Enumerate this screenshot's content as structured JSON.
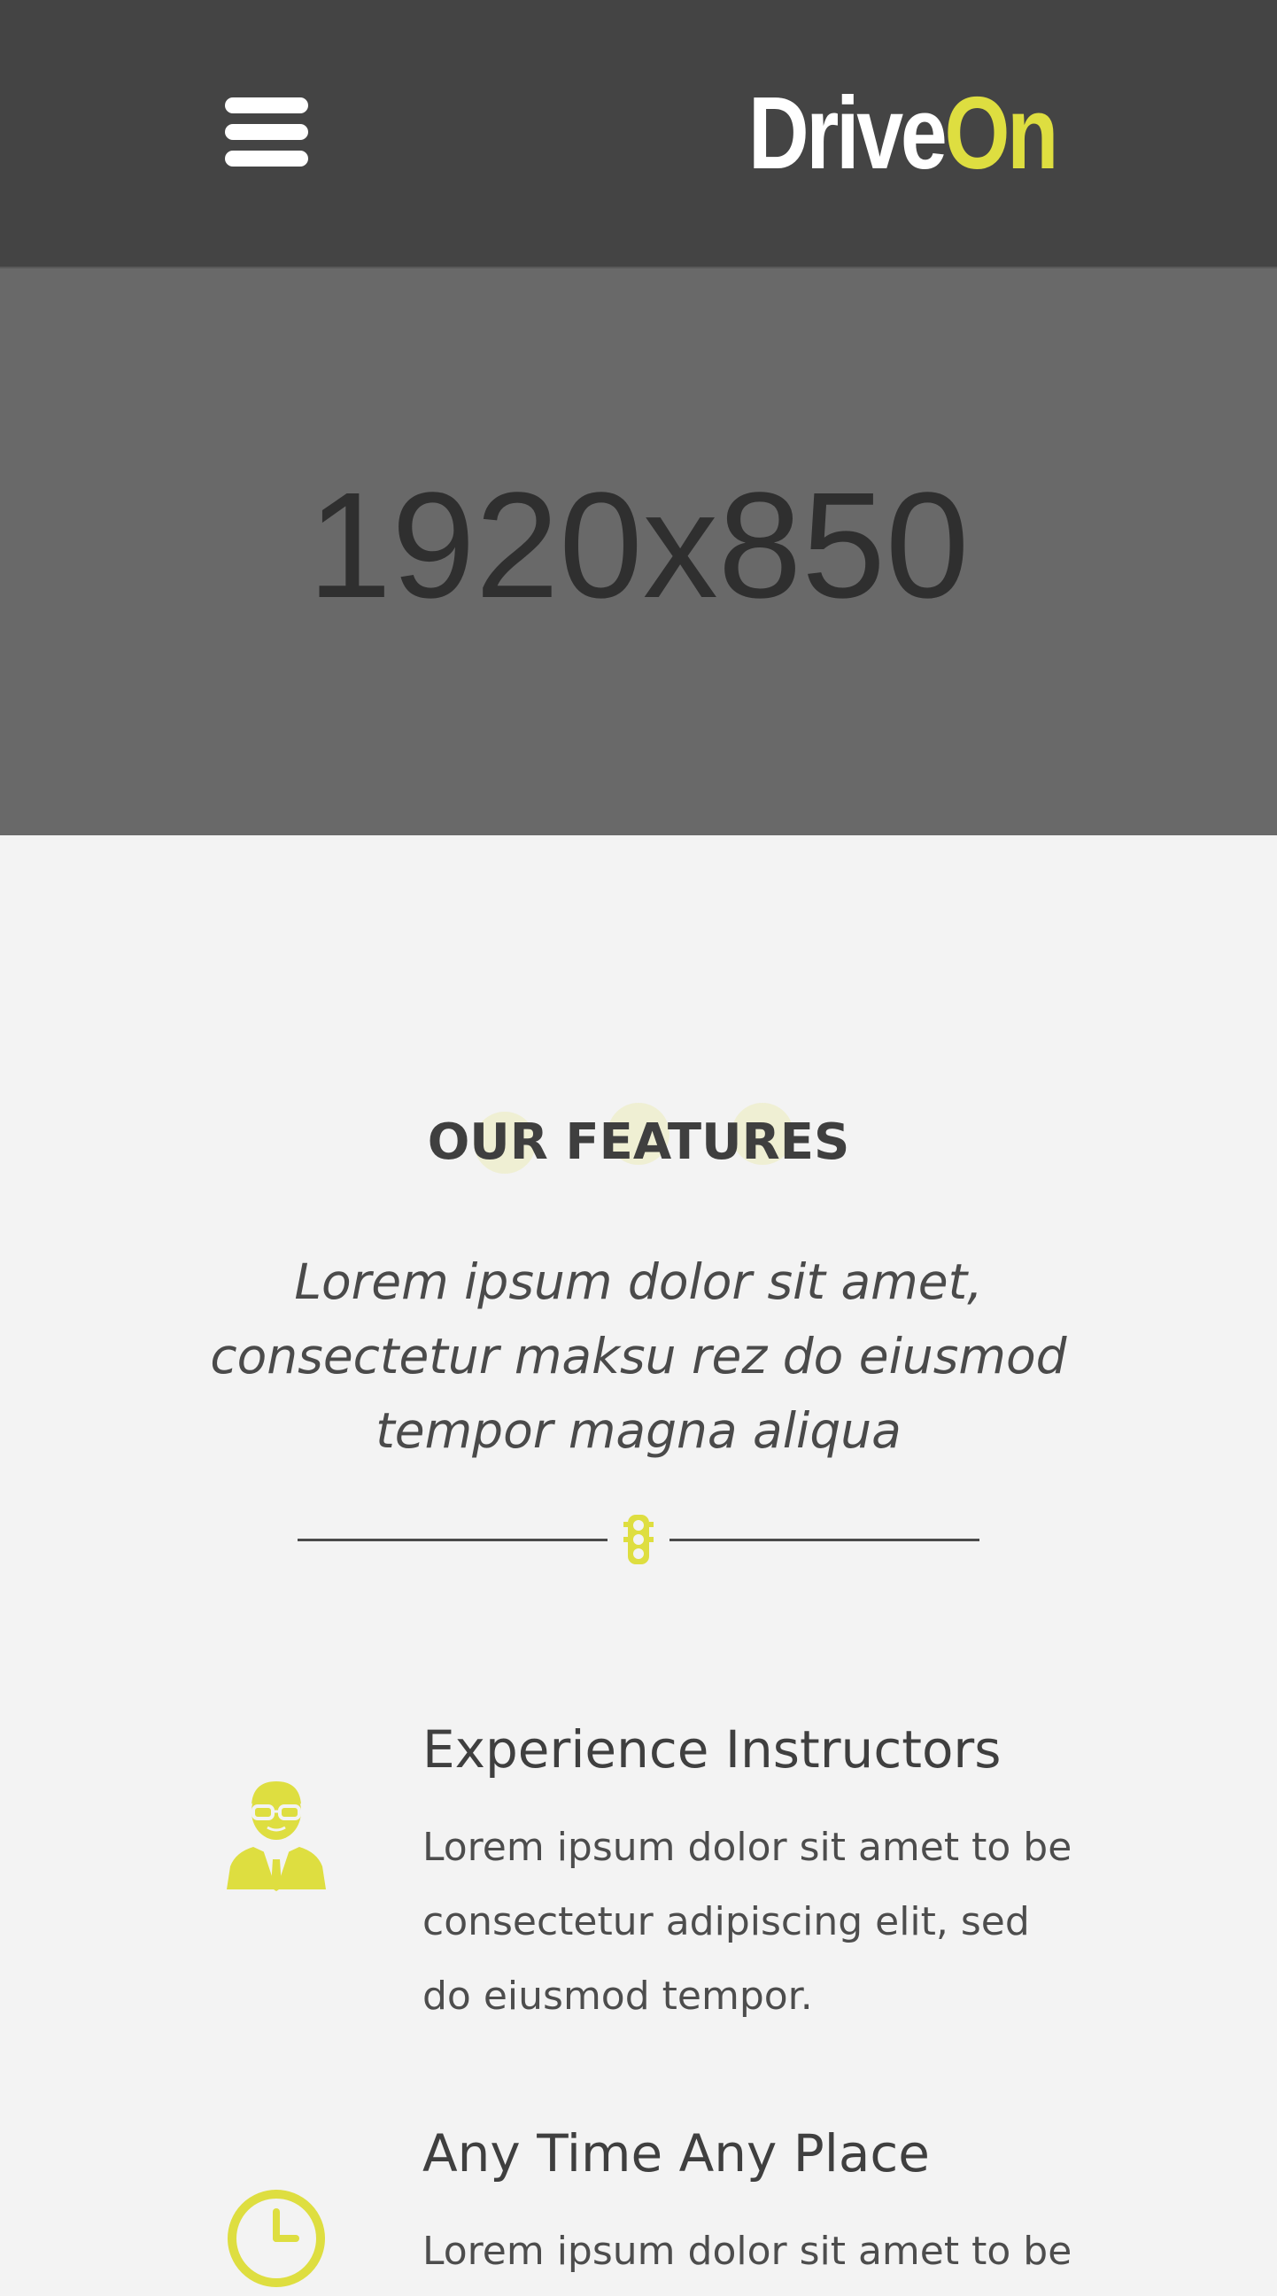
{
  "header": {
    "menu_icon": "hamburger-menu-icon",
    "logo": {
      "part1": "Drive",
      "part2": "On"
    }
  },
  "hero": {
    "placeholder_text": "1920x850"
  },
  "features": {
    "title": "OUR FEATURES",
    "subtitle": "Lorem ipsum dolor sit amet, consectetur maksu rez do eiusmod tempor magna aliqua",
    "divider_icon": "traffic-light-icon",
    "items": [
      {
        "icon": "instructor-icon",
        "heading": "Experience Instructors",
        "text": "Lorem ipsum dolor sit amet to be consectetur adipiscing elit, sed do eiusmod tempor."
      },
      {
        "icon": "clock-icon",
        "heading": "Any Time Any Place",
        "text": "Lorem ipsum dolor sit amet to be"
      }
    ]
  },
  "colors": {
    "accent": "#dede40",
    "header_bg": "#444444",
    "hero_bg": "#696969",
    "page_bg": "#f3f3f3",
    "text_dark": "#3f3f3f"
  }
}
